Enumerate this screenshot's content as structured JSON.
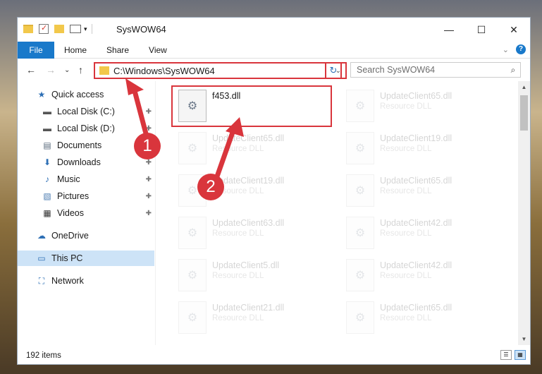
{
  "window": {
    "title": "SysWOW64",
    "controls": {
      "minimize": "—",
      "maximize": "☐",
      "close": "✕"
    }
  },
  "ribbon": {
    "tabs": [
      "File",
      "Home",
      "Share",
      "View"
    ],
    "expand": "⌄",
    "help": "?"
  },
  "nav": {
    "back": "←",
    "forward": "→",
    "recent": "⌄",
    "up": "↑",
    "address": "C:\\Windows\\SysWOW64",
    "address_chevron": "⌄",
    "refresh": "↻",
    "search_placeholder": "Search SysWOW64",
    "search_icon": "⌕"
  },
  "sidebar": {
    "items": [
      {
        "label": "Quick access",
        "icon": "star-icon",
        "glyph": "★",
        "pinned": false
      },
      {
        "label": "Local Disk (C:)",
        "icon": "drive-icon",
        "glyph": "▬",
        "pinned": true
      },
      {
        "label": "Local Disk (D:)",
        "icon": "drive-icon",
        "glyph": "▬",
        "pinned": true
      },
      {
        "label": "Documents",
        "icon": "document-icon",
        "glyph": "▤",
        "pinned": true
      },
      {
        "label": "Downloads",
        "icon": "download-icon",
        "glyph": "⬇",
        "pinned": true
      },
      {
        "label": "Music",
        "icon": "music-icon",
        "glyph": "♪",
        "pinned": true
      },
      {
        "label": "Pictures",
        "icon": "pictures-icon",
        "glyph": "▧",
        "pinned": true
      },
      {
        "label": "Videos",
        "icon": "video-icon",
        "glyph": "▦",
        "pinned": true
      },
      {
        "label": "OneDrive",
        "icon": "cloud-icon",
        "glyph": "☁",
        "pinned": false
      },
      {
        "label": "This PC",
        "icon": "computer-icon",
        "glyph": "▭",
        "pinned": false,
        "selected": true
      },
      {
        "label": "Network",
        "icon": "network-icon",
        "glyph": "⛶",
        "pinned": false
      }
    ],
    "pin_glyph": "📌"
  },
  "files": [
    {
      "name": "f453.dll",
      "type": ""
    },
    {
      "name": "UpdateClient65.dll",
      "type": "Resource DLL"
    },
    {
      "name": "UpdateClient65.dll",
      "type": "Resource DLL"
    },
    {
      "name": "UpdateClient19.dll",
      "type": "Resource DLL"
    },
    {
      "name": "UpdateClient19.dll",
      "type": "Resource DLL"
    },
    {
      "name": "UpdateClient65.dll",
      "type": "Resource DLL"
    },
    {
      "name": "UpdateClient63.dll",
      "type": "Resource DLL"
    },
    {
      "name": "UpdateClient42.dll",
      "type": "Resource DLL"
    },
    {
      "name": "UpdateClient5.dll",
      "type": "Resource DLL"
    },
    {
      "name": "UpdateClient42.dll",
      "type": "Resource DLL"
    },
    {
      "name": "UpdateClient21.dll",
      "type": "Resource DLL"
    },
    {
      "name": "UpdateClient65.dll",
      "type": "Resource DLL"
    }
  ],
  "status": {
    "item_count": "192 items"
  },
  "annotations": {
    "badge1": "1",
    "badge2": "2"
  },
  "colors": {
    "accent": "#1979ca",
    "highlight": "#d9353c",
    "selection": "#cde3f7"
  }
}
